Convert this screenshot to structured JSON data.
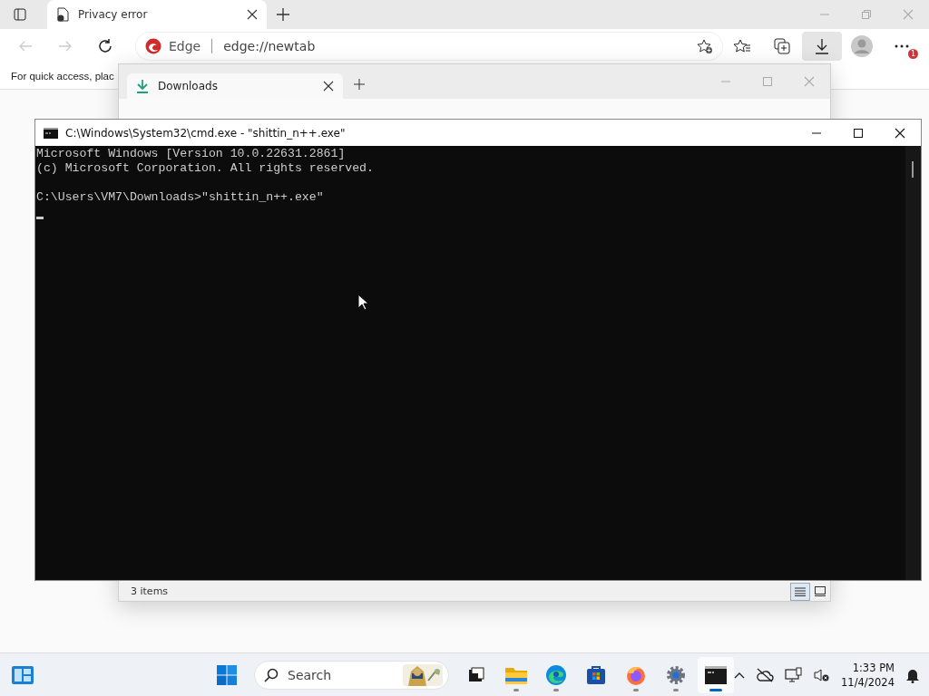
{
  "browser": {
    "tab": {
      "title": "Privacy error"
    },
    "address": {
      "site_label": "Edge",
      "url": "edge://newtab"
    },
    "downloads_button": {
      "selected": true
    },
    "more_badge": "1",
    "favorites_bar_text": "For quick access, plac"
  },
  "explorer": {
    "tab": {
      "title": "Downloads"
    },
    "status": "3 items",
    "view_buttons": [
      {
        "kind": "details",
        "selected": true
      },
      {
        "kind": "tiles",
        "selected": false
      }
    ]
  },
  "cmd": {
    "title": "C:\\Windows\\System32\\cmd.exe - \"shittin_n++.exe\"",
    "banner": [
      "Microsoft Windows [Version 10.0.22631.2861]",
      "(c) Microsoft Corporation. All rights reserved."
    ],
    "prompt": "C:\\Users\\VM7\\Downloads>\"shittin_n++.exe\""
  },
  "taskbar": {
    "search": {
      "placeholder": "Search"
    },
    "apps": [
      {
        "kind": "task-view",
        "running": false,
        "selected": false
      },
      {
        "kind": "folder",
        "running": true,
        "selected": false
      },
      {
        "kind": "edge",
        "running": true,
        "selected": false
      },
      {
        "kind": "store",
        "running": false,
        "selected": false
      },
      {
        "kind": "firefox",
        "running": true,
        "selected": false
      },
      {
        "kind": "settings",
        "running": true,
        "selected": false
      },
      {
        "kind": "terminal",
        "running": true,
        "selected": true
      }
    ],
    "clock": {
      "time": "1:33 PM",
      "date": "11/4/2024"
    }
  }
}
